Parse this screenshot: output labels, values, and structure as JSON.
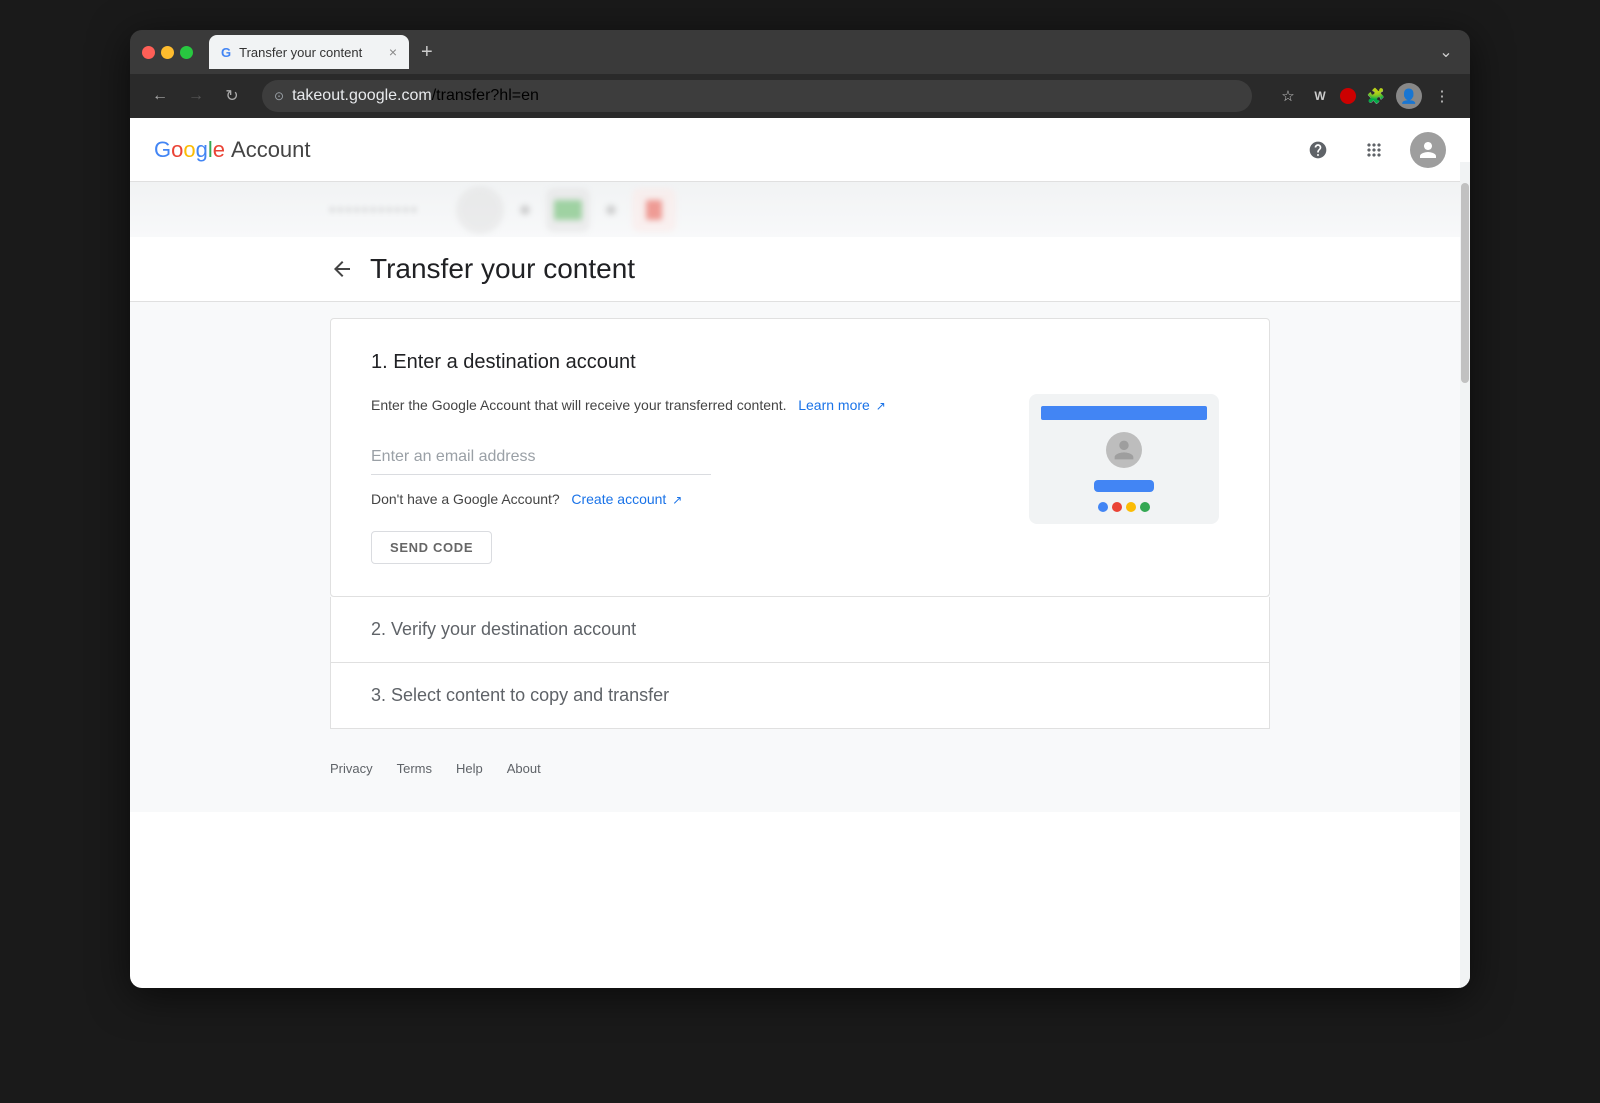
{
  "browser": {
    "tab_title": "Transfer your content",
    "tab_favicon": "G",
    "url_domain": "takeout.google.com",
    "url_path": "/transfer?hl=en",
    "new_tab_label": "+",
    "close_tab_label": "×"
  },
  "header": {
    "logo_g": "G",
    "logo_o1": "o",
    "logo_o2": "o",
    "logo_g2": "g",
    "logo_l": "l",
    "logo_e": "e",
    "logo_account": "Account",
    "help_icon": "?",
    "apps_icon": "⋮⋮⋮"
  },
  "page": {
    "back_arrow": "←",
    "title": "Transfer your content"
  },
  "step1": {
    "title": "1. Enter a destination account",
    "description": "Enter the Google Account that will receive your transferred content.",
    "learn_more": "Learn more",
    "email_placeholder": "Enter an email address",
    "no_account_text": "Don't have a Google Account?",
    "create_account_link": "Create account",
    "send_code_btn": "SEND CODE"
  },
  "step2": {
    "title": "2. Verify your destination account"
  },
  "step3": {
    "title": "3. Select content to copy and transfer"
  },
  "footer": {
    "links": [
      "Privacy",
      "Terms",
      "Help",
      "About"
    ]
  },
  "illustration": {
    "dots": [
      {
        "color": "#4285f4"
      },
      {
        "color": "#ea4335"
      },
      {
        "color": "#fbbc05"
      },
      {
        "color": "#34a853"
      }
    ]
  }
}
